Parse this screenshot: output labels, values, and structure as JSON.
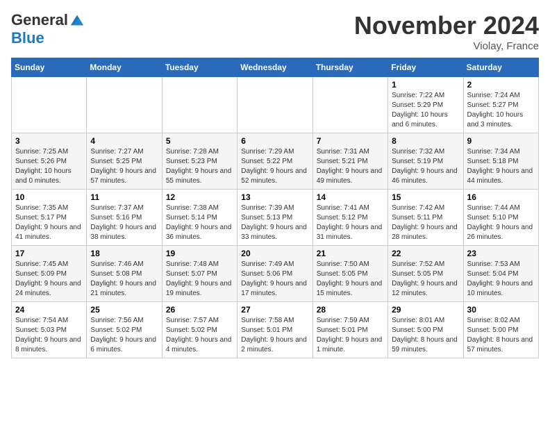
{
  "header": {
    "logo_general": "General",
    "logo_blue": "Blue",
    "month_title": "November 2024",
    "location": "Violay, France"
  },
  "weekdays": [
    "Sunday",
    "Monday",
    "Tuesday",
    "Wednesday",
    "Thursday",
    "Friday",
    "Saturday"
  ],
  "weeks": [
    [
      {
        "day": "",
        "info": ""
      },
      {
        "day": "",
        "info": ""
      },
      {
        "day": "",
        "info": ""
      },
      {
        "day": "",
        "info": ""
      },
      {
        "day": "",
        "info": ""
      },
      {
        "day": "1",
        "info": "Sunrise: 7:22 AM\nSunset: 5:29 PM\nDaylight: 10 hours and 6 minutes."
      },
      {
        "day": "2",
        "info": "Sunrise: 7:24 AM\nSunset: 5:27 PM\nDaylight: 10 hours and 3 minutes."
      }
    ],
    [
      {
        "day": "3",
        "info": "Sunrise: 7:25 AM\nSunset: 5:26 PM\nDaylight: 10 hours and 0 minutes."
      },
      {
        "day": "4",
        "info": "Sunrise: 7:27 AM\nSunset: 5:25 PM\nDaylight: 9 hours and 57 minutes."
      },
      {
        "day": "5",
        "info": "Sunrise: 7:28 AM\nSunset: 5:23 PM\nDaylight: 9 hours and 55 minutes."
      },
      {
        "day": "6",
        "info": "Sunrise: 7:29 AM\nSunset: 5:22 PM\nDaylight: 9 hours and 52 minutes."
      },
      {
        "day": "7",
        "info": "Sunrise: 7:31 AM\nSunset: 5:21 PM\nDaylight: 9 hours and 49 minutes."
      },
      {
        "day": "8",
        "info": "Sunrise: 7:32 AM\nSunset: 5:19 PM\nDaylight: 9 hours and 46 minutes."
      },
      {
        "day": "9",
        "info": "Sunrise: 7:34 AM\nSunset: 5:18 PM\nDaylight: 9 hours and 44 minutes."
      }
    ],
    [
      {
        "day": "10",
        "info": "Sunrise: 7:35 AM\nSunset: 5:17 PM\nDaylight: 9 hours and 41 minutes."
      },
      {
        "day": "11",
        "info": "Sunrise: 7:37 AM\nSunset: 5:16 PM\nDaylight: 9 hours and 38 minutes."
      },
      {
        "day": "12",
        "info": "Sunrise: 7:38 AM\nSunset: 5:14 PM\nDaylight: 9 hours and 36 minutes."
      },
      {
        "day": "13",
        "info": "Sunrise: 7:39 AM\nSunset: 5:13 PM\nDaylight: 9 hours and 33 minutes."
      },
      {
        "day": "14",
        "info": "Sunrise: 7:41 AM\nSunset: 5:12 PM\nDaylight: 9 hours and 31 minutes."
      },
      {
        "day": "15",
        "info": "Sunrise: 7:42 AM\nSunset: 5:11 PM\nDaylight: 9 hours and 28 minutes."
      },
      {
        "day": "16",
        "info": "Sunrise: 7:44 AM\nSunset: 5:10 PM\nDaylight: 9 hours and 26 minutes."
      }
    ],
    [
      {
        "day": "17",
        "info": "Sunrise: 7:45 AM\nSunset: 5:09 PM\nDaylight: 9 hours and 24 minutes."
      },
      {
        "day": "18",
        "info": "Sunrise: 7:46 AM\nSunset: 5:08 PM\nDaylight: 9 hours and 21 minutes."
      },
      {
        "day": "19",
        "info": "Sunrise: 7:48 AM\nSunset: 5:07 PM\nDaylight: 9 hours and 19 minutes."
      },
      {
        "day": "20",
        "info": "Sunrise: 7:49 AM\nSunset: 5:06 PM\nDaylight: 9 hours and 17 minutes."
      },
      {
        "day": "21",
        "info": "Sunrise: 7:50 AM\nSunset: 5:05 PM\nDaylight: 9 hours and 15 minutes."
      },
      {
        "day": "22",
        "info": "Sunrise: 7:52 AM\nSunset: 5:05 PM\nDaylight: 9 hours and 12 minutes."
      },
      {
        "day": "23",
        "info": "Sunrise: 7:53 AM\nSunset: 5:04 PM\nDaylight: 9 hours and 10 minutes."
      }
    ],
    [
      {
        "day": "24",
        "info": "Sunrise: 7:54 AM\nSunset: 5:03 PM\nDaylight: 9 hours and 8 minutes."
      },
      {
        "day": "25",
        "info": "Sunrise: 7:56 AM\nSunset: 5:02 PM\nDaylight: 9 hours and 6 minutes."
      },
      {
        "day": "26",
        "info": "Sunrise: 7:57 AM\nSunset: 5:02 PM\nDaylight: 9 hours and 4 minutes."
      },
      {
        "day": "27",
        "info": "Sunrise: 7:58 AM\nSunset: 5:01 PM\nDaylight: 9 hours and 2 minutes."
      },
      {
        "day": "28",
        "info": "Sunrise: 7:59 AM\nSunset: 5:01 PM\nDaylight: 9 hours and 1 minute."
      },
      {
        "day": "29",
        "info": "Sunrise: 8:01 AM\nSunset: 5:00 PM\nDaylight: 8 hours and 59 minutes."
      },
      {
        "day": "30",
        "info": "Sunrise: 8:02 AM\nSunset: 5:00 PM\nDaylight: 8 hours and 57 minutes."
      }
    ]
  ]
}
